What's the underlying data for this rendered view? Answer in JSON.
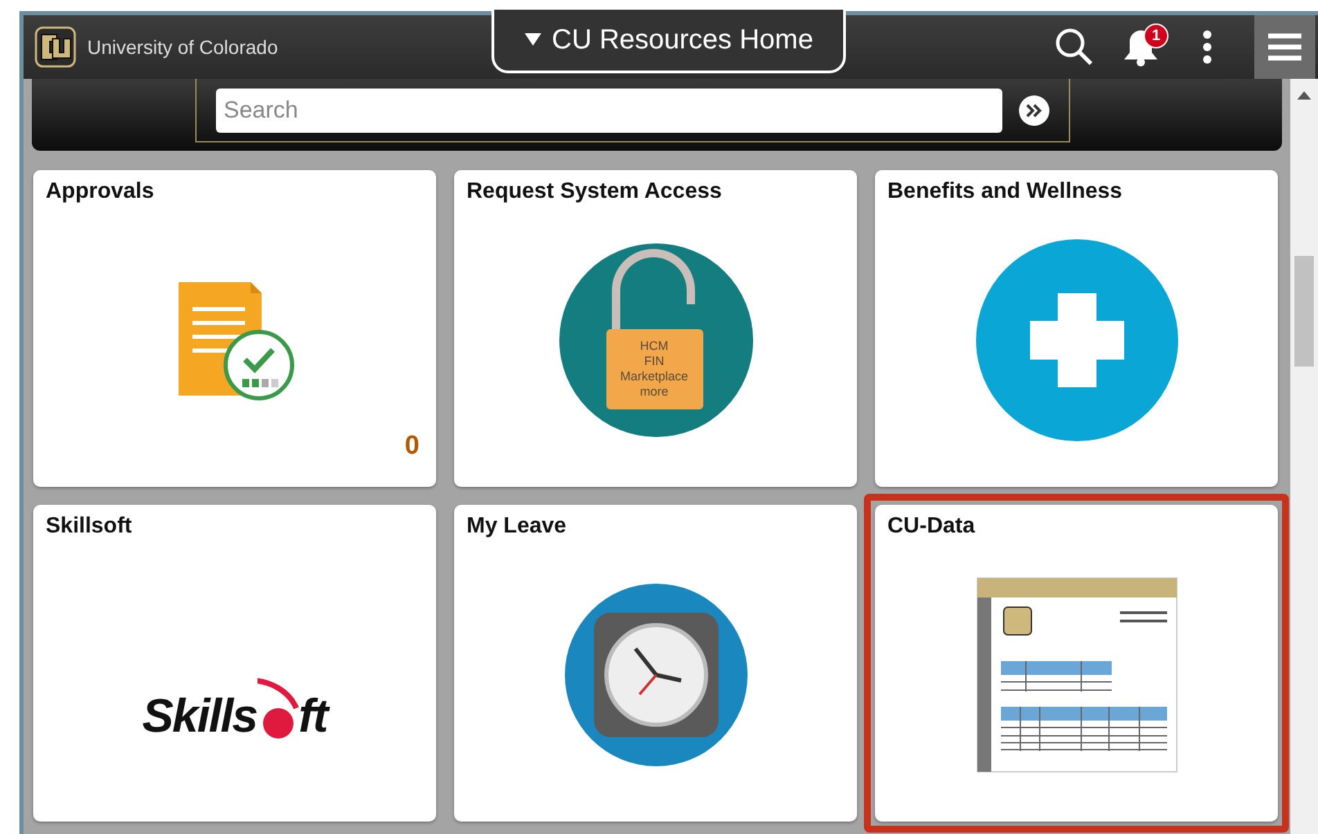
{
  "header": {
    "brand": "University of Colorado",
    "title": "CU Resources Home",
    "notification_count": "1"
  },
  "search": {
    "placeholder": "Search"
  },
  "tiles": [
    {
      "kind": "approvals",
      "title": "Approvals",
      "count": "0",
      "highlighted": false
    },
    {
      "kind": "lock",
      "title": "Request System Access",
      "lines": [
        "HCM",
        "FIN",
        "Marketplace",
        "more"
      ],
      "highlighted": false
    },
    {
      "kind": "plus",
      "title": "Benefits and Wellness",
      "highlighted": false
    },
    {
      "kind": "logo",
      "title": "Skillsoft",
      "logo_text": [
        "Skills",
        "ft"
      ],
      "highlighted": false
    },
    {
      "kind": "clock",
      "title": "My Leave",
      "highlighted": false
    },
    {
      "kind": "report",
      "title": "CU-Data",
      "highlighted": true
    }
  ]
}
